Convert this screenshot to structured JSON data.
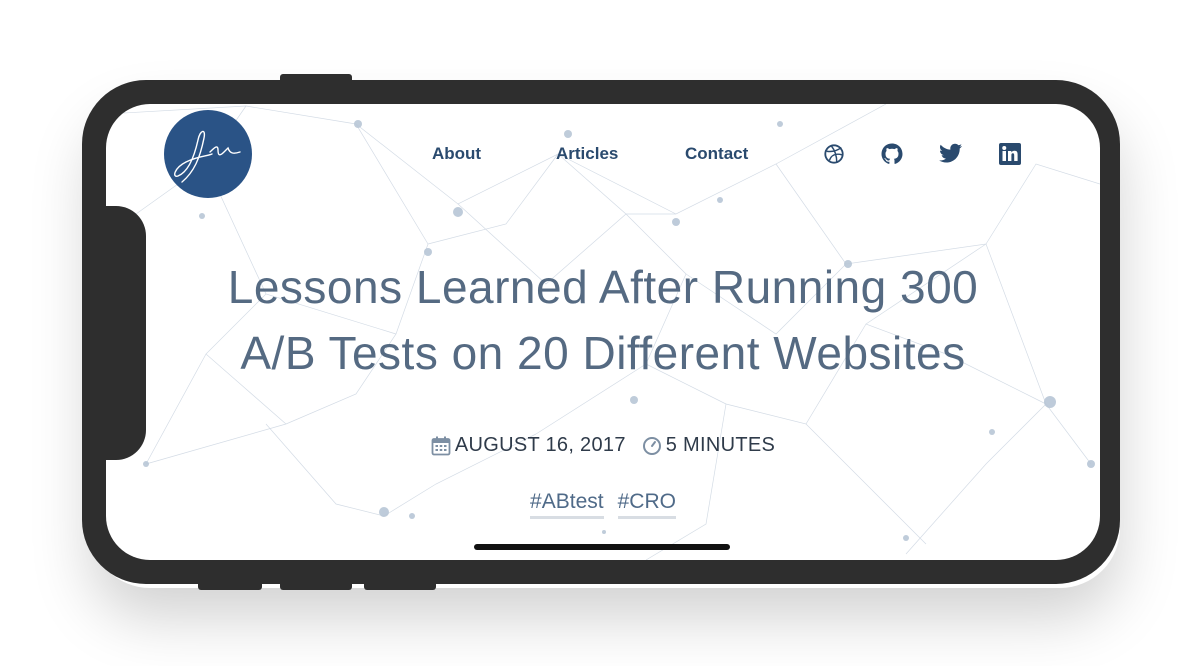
{
  "nav": {
    "logo_alt": "signature logo",
    "links": [
      "About",
      "Articles",
      "Contact"
    ]
  },
  "social": [
    {
      "name": "dribbble-icon"
    },
    {
      "name": "github-icon"
    },
    {
      "name": "twitter-icon"
    },
    {
      "name": "linkedin-icon"
    }
  ],
  "article": {
    "title_line1": "Lessons Learned After Running 300",
    "title_line2": "A/B Tests on 20 Different Websites",
    "date": "AUGUST 16, 2017",
    "read_time": "5 MINUTES",
    "tags": [
      "#ABtest",
      "#CRO"
    ]
  },
  "colors": {
    "brand": "#2a5386",
    "nav_text": "#2a4a6e",
    "title": "#556a82",
    "device": "#2e2e2e"
  }
}
